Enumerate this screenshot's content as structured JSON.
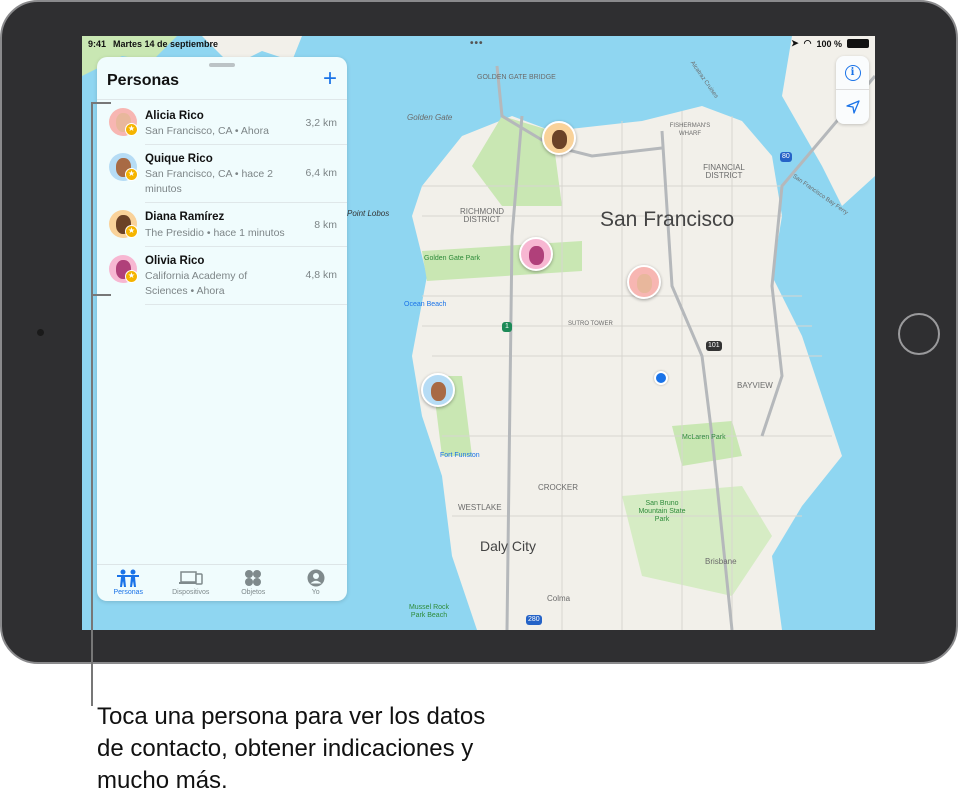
{
  "status_bar": {
    "time": "9:41",
    "date": "Martes 14 de septiembre",
    "battery": "100 %"
  },
  "panel": {
    "title": "Personas",
    "add_icon": "plus-icon"
  },
  "people": [
    {
      "name": "Alicia Rico",
      "location": "San Francisco, CA • Ahora",
      "distance": "3,2 km",
      "color": "#f7b6b2"
    },
    {
      "name": "Quique Rico",
      "location": "San Francisco, CA • hace 2 minutos",
      "distance": "6,4 km",
      "color": "#b6dcf5"
    },
    {
      "name": "Diana Ramírez",
      "location": "The Presidio • hace 1 minutos",
      "distance": "8 km",
      "color": "#f9d29a"
    },
    {
      "name": "Olivia Rico",
      "location": "California Academy of Sciences • Ahora",
      "distance": "4,8 km",
      "color": "#f7b7d2"
    }
  ],
  "tabs": [
    {
      "label": "Personas",
      "icon": "people-icon",
      "active": true
    },
    {
      "label": "Dispositivos",
      "icon": "devices-icon",
      "active": false
    },
    {
      "label": "Objetos",
      "icon": "items-icon",
      "active": false
    },
    {
      "label": "Yo",
      "icon": "me-icon",
      "active": false
    }
  ],
  "map": {
    "city": "San Francisco",
    "labels": {
      "ggb": "Golden Gate Bridge",
      "golden_gate": "Golden Gate",
      "point_lobos": "Point Lobos",
      "richmond": "Richmond District",
      "ggpark": "Golden Gate Park",
      "ocean_beach": "Ocean Beach",
      "sutro": "Sutro Tower",
      "fishermans": "Fisherman's Wharf",
      "financial": "Financial District",
      "alcatraz": "Alcatraz Cruises",
      "ferry": "San Francisco Bay Ferry",
      "bayview": "Bayview",
      "mclaren": "McLaren Park",
      "fort_funston": "Fort Funston",
      "crocker": "Crocker",
      "westlake": "Westlake",
      "daly_city": "Daly City",
      "san_bruno": "San Bruno Mountain State Park",
      "brisbane": "Brisbane",
      "colma": "Colma",
      "mussel_rock": "Mussel Rock Park Beach"
    },
    "highways": [
      "80",
      "101",
      "1",
      "280"
    ],
    "colors": {
      "water": "#8fd6f1",
      "land": "#f2f0ea",
      "park": "#c9e7b3",
      "accent": "#1a73e8"
    }
  },
  "caption": "Toca una persona para ver los datos de contacto, obtener indicaciones y mucho más."
}
